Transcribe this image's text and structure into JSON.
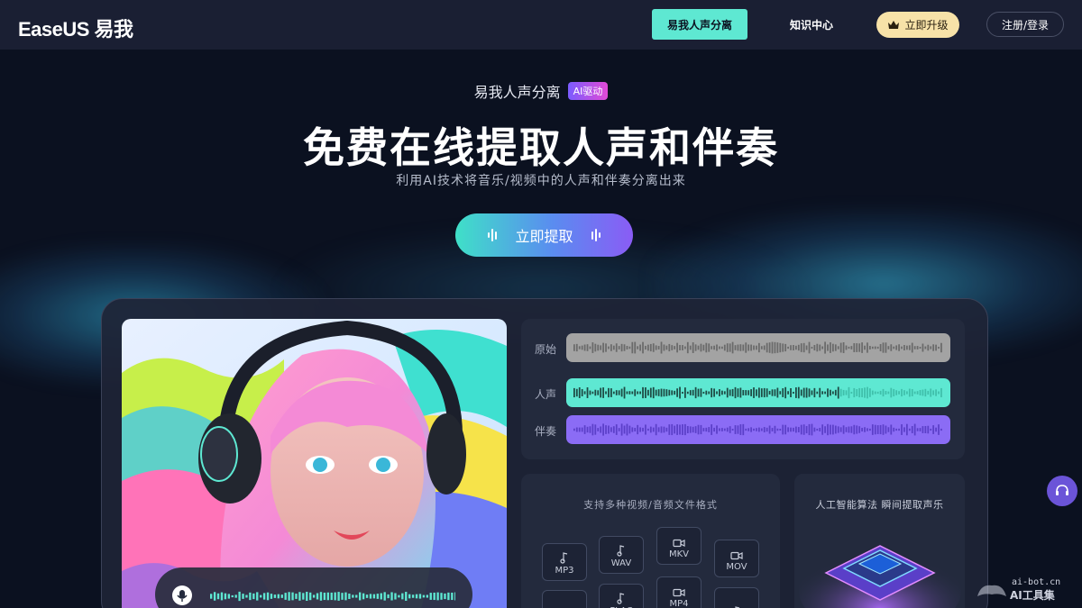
{
  "nav": {
    "logo": "EaseUS 易我",
    "items": [
      {
        "label": "易我人声分离",
        "active": true
      },
      {
        "label": "知识中心",
        "active": false
      }
    ],
    "upgrade_label": "立即升级",
    "login_label": "注册/登录"
  },
  "hero": {
    "product": "易我人声分离",
    "badge": "AI驱动",
    "title": "免费在线提取人声和伴奏",
    "description": "利用AI技术将音乐/视频中的人声和伴奏分离出来",
    "cta_label": "立即提取"
  },
  "waveform": {
    "tracks": [
      {
        "label": "原始",
        "color": "#a3a3a3"
      },
      {
        "label": "人声",
        "color": "#5ee8d2"
      },
      {
        "label": "伴奏",
        "color": "#8b6cf5"
      }
    ]
  },
  "formats": {
    "title": "支持多种视频/音频文件格式",
    "items": [
      "MP3",
      "WAV",
      "MKV",
      "MOV",
      "",
      "FLAC",
      "MP4",
      ""
    ]
  },
  "ai": {
    "title": "人工智能算法   瞬间提取声乐"
  },
  "watermark": {
    "url": "ai-bot.cn",
    "name": "AI工具集"
  },
  "colors": {
    "accent": "#5ee8d2",
    "upgrade_bg": "#f7e2a8",
    "purple": "#8b6cf5",
    "bg": "#0b1120"
  }
}
